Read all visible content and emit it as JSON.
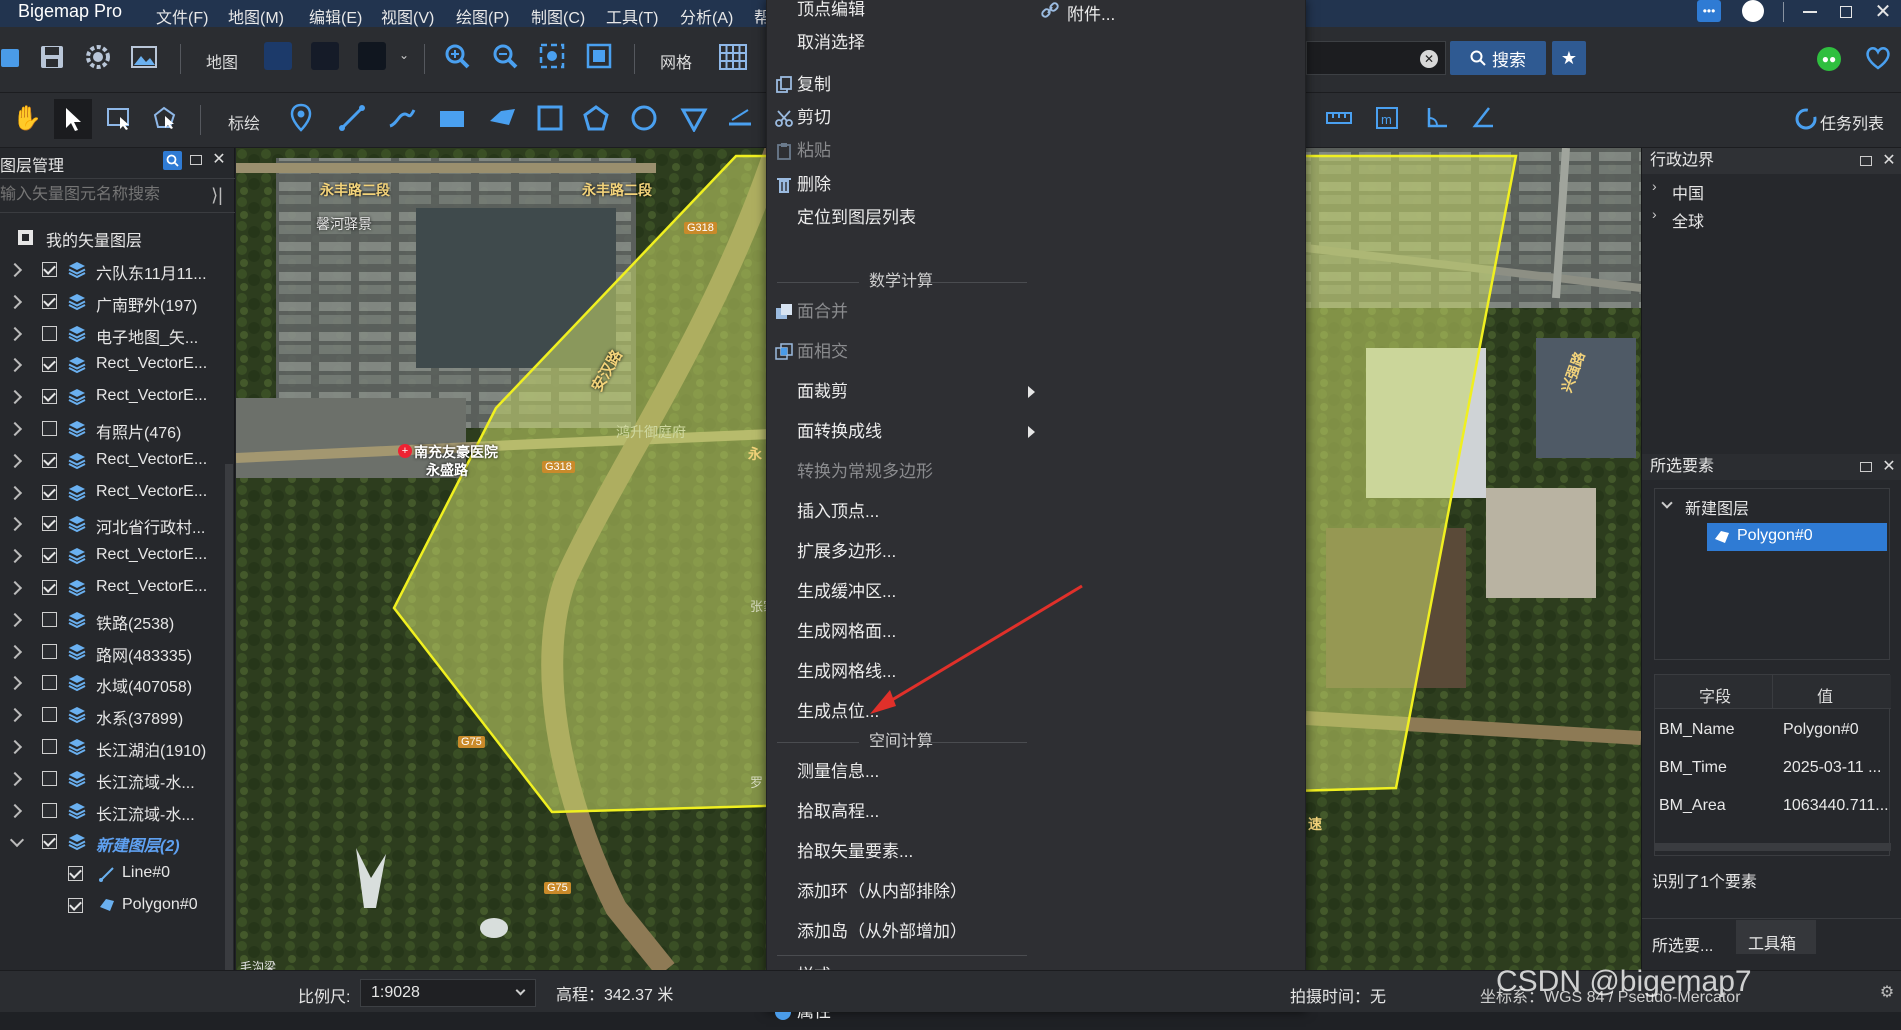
{
  "app": {
    "title": "Bigemap Pro"
  },
  "menubar": [
    "文件(F)",
    "地图(M)",
    "编辑(E)",
    "视图(V)",
    "绘图(P)",
    "制图(C)",
    "工具(T)",
    "分析(A)",
    "帮"
  ],
  "toolbar1": {
    "map_label": "地图",
    "grid_label": "网格",
    "search_button": "搜索"
  },
  "toolbar2": {
    "draw_label": "标绘",
    "task_list": "任务列表"
  },
  "layer_panel": {
    "title": "图层管理",
    "search_placeholder": "输入矢量图元名称搜索",
    "root": "我的矢量图层",
    "layers": [
      {
        "name": "六队东11月11...",
        "checked": true
      },
      {
        "name": "广南野外(197)",
        "checked": true
      },
      {
        "name": "电子地图_矢...",
        "checked": false
      },
      {
        "name": "Rect_VectorE...",
        "checked": true
      },
      {
        "name": "Rect_VectorE...",
        "checked": true
      },
      {
        "name": "有照片(476)",
        "checked": false
      },
      {
        "name": "Rect_VectorE...",
        "checked": true
      },
      {
        "name": "Rect_VectorE...",
        "checked": true
      },
      {
        "name": "河北省行政村...",
        "checked": true
      },
      {
        "name": "Rect_VectorE...",
        "checked": true
      },
      {
        "name": "Rect_VectorE...",
        "checked": true
      },
      {
        "name": "铁路(2538)",
        "checked": false
      },
      {
        "name": "路网(483335)",
        "checked": false
      },
      {
        "name": "水域(407058)",
        "checked": false
      },
      {
        "name": "水系(37899)",
        "checked": false
      },
      {
        "name": "长江湖泊(1910)",
        "checked": false
      },
      {
        "name": "长江流域-水...",
        "checked": false
      },
      {
        "name": "长江流域-水...",
        "checked": false
      }
    ],
    "new_layer": "新建图层(2)",
    "children": [
      "Line#0",
      "Polygon#0"
    ]
  },
  "map_labels": {
    "road1": "永丰路二段",
    "road2": "永丰路二段",
    "place1": "馨河驿景",
    "g318a": "G318",
    "g318b": "G318",
    "anhan": "安汉路",
    "hospital": "南充友豪医院",
    "yongsheng": "永盛路",
    "place2": "鸿升御庭府",
    "zhangjia": "张家沟",
    "g75a": "G75",
    "g75b": "G75",
    "maoshagou": "毛沟梁",
    "xingshan": "兴强路",
    "su": "速",
    "yong": "永",
    "luo": "罗"
  },
  "context_menu": {
    "items_top": [
      {
        "label": "顶点编辑",
        "disabled": false,
        "icon": ""
      },
      {
        "label": "取消选择",
        "disabled": false,
        "icon": ""
      },
      {
        "label": "复制",
        "disabled": false,
        "icon": "copy-icon"
      },
      {
        "label": "剪切",
        "disabled": false,
        "icon": "scissors-icon"
      },
      {
        "label": "粘贴",
        "disabled": true,
        "icon": "paste-icon"
      },
      {
        "label": "删除",
        "disabled": false,
        "icon": "trash-icon"
      },
      {
        "label": "定位到图层列表",
        "disabled": false,
        "icon": ""
      }
    ],
    "section_math": "数学计算",
    "items_math": [
      {
        "label": "面合并",
        "disabled": true,
        "icon": "merge-icon",
        "submenu": false
      },
      {
        "label": "面相交",
        "disabled": true,
        "icon": "intersect-icon",
        "submenu": false
      },
      {
        "label": "面裁剪",
        "disabled": false,
        "icon": "",
        "submenu": true
      },
      {
        "label": "面转换成线",
        "disabled": false,
        "icon": "",
        "submenu": true
      },
      {
        "label": "转换为常规多边形",
        "disabled": true,
        "icon": "",
        "submenu": false
      },
      {
        "label": "插入顶点...",
        "disabled": false,
        "icon": "",
        "submenu": false
      },
      {
        "label": "扩展多边形...",
        "disabled": false,
        "icon": "",
        "submenu": false
      },
      {
        "label": "生成缓冲区...",
        "disabled": false,
        "icon": "",
        "submenu": false
      },
      {
        "label": "生成网格面...",
        "disabled": false,
        "icon": "",
        "submenu": false
      },
      {
        "label": "生成网格线...",
        "disabled": false,
        "icon": "",
        "submenu": false
      },
      {
        "label": "生成点位...",
        "disabled": false,
        "icon": "",
        "submenu": false
      }
    ],
    "section_space": "空间计算",
    "items_space": [
      {
        "label": "测量信息...",
        "disabled": false
      },
      {
        "label": "拾取高程...",
        "disabled": false
      },
      {
        "label": "拾取矢量要素...",
        "disabled": false
      },
      {
        "label": "添加环（从内部排除）",
        "disabled": false
      },
      {
        "label": "添加岛（从外部增加）",
        "disabled": false
      }
    ],
    "style": "样式...",
    "attach": "附件...",
    "cut_bottom": "属性"
  },
  "right_panel": {
    "admin_title": "行政边界",
    "admin_items": [
      "中国",
      "全球"
    ],
    "selected_title": "所选要素",
    "selected_layer": "新建图层",
    "selected_feature": "Polygon#0",
    "table_headers": [
      "字段",
      "值"
    ],
    "table_rows": [
      {
        "field": "BM_Name",
        "value": "Polygon#0"
      },
      {
        "field": "BM_Time",
        "value": "2025-03-11 ..."
      },
      {
        "field": "BM_Area",
        "value": "1063440.711..."
      }
    ],
    "identified": "识别了1个要素",
    "tabs": [
      "所选要...",
      "工具箱"
    ]
  },
  "statusbar": {
    "scale_label": "比例尺:",
    "scale_value": "1:9028",
    "elevation": "高程：342.37 米",
    "capture_time": "拍摄时间：无",
    "coord_label": "坐标系：WGS 84 / Pseudo-Mercator",
    "watermark": "CSDN @bigemap7"
  },
  "colors": {
    "selection": "#2f7bd4",
    "polygon_fill": "#c8d86a",
    "polygon_stroke": "#f0f020",
    "arrow": "#e0302a",
    "new_layer": "#5ea0f0"
  }
}
